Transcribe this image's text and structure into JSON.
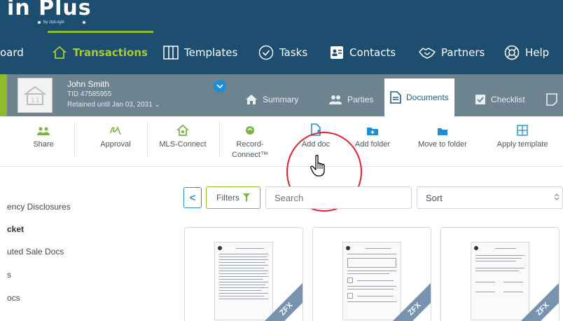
{
  "app": {
    "logo_text": "in Plus",
    "logo_sub": "by zipLogix"
  },
  "nav": {
    "items": [
      {
        "label": "oard",
        "icon": "none"
      },
      {
        "label": "Transactions",
        "icon": "home-icon",
        "active": true
      },
      {
        "label": "Templates",
        "icon": "template-icon"
      },
      {
        "label": "Tasks",
        "icon": "check-circle-icon"
      },
      {
        "label": "Contacts",
        "icon": "contact-card-icon"
      },
      {
        "label": "Partners",
        "icon": "handshake-icon"
      },
      {
        "label": "Help",
        "icon": "lifebuoy-icon"
      }
    ]
  },
  "file": {
    "name": "John Smith",
    "tid": "TID 47585955",
    "retained": "Retained until Jan 03, 2031 ⌄"
  },
  "tabs": [
    {
      "label": "Summary",
      "icon": "home-icon"
    },
    {
      "label": "Parties",
      "icon": "people-icon"
    },
    {
      "label": "Documents",
      "icon": "document-icon",
      "active": true
    },
    {
      "label": "Checklist",
      "icon": "checklist-icon"
    }
  ],
  "toolbar": {
    "share": "Share",
    "approval": "Approval",
    "mls_connect": "MLS-Connect",
    "record_connect_1": "Record-",
    "record_connect_2": "Connect™",
    "add_doc": "Add doc",
    "add_folder": "Add folder",
    "move_to_folder": "Move to folder",
    "apply_template": "Apply template"
  },
  "sidebar": {
    "items": [
      {
        "label": "ency Disclosures",
        "bold": false
      },
      {
        "label": "cket",
        "bold": true
      },
      {
        "label": "uted Sale Docs",
        "bold": false
      },
      {
        "label": "s",
        "bold": false
      },
      {
        "label": "ocs",
        "bold": false
      }
    ]
  },
  "filters": {
    "back": "<",
    "filters_label": "Filters",
    "search_placeholder": "Search",
    "sort_label": "Sort"
  },
  "documents": [
    {
      "badge": "ZFX"
    },
    {
      "badge": "ZFX"
    },
    {
      "badge": "ZFX"
    }
  ],
  "colors": {
    "nav_bg": "#1d4e6f",
    "accent_green": "#8dbb2b",
    "file_bar": "#6e8390",
    "highlight_ring": "#e0202a",
    "link_blue": "#1d5d86"
  }
}
